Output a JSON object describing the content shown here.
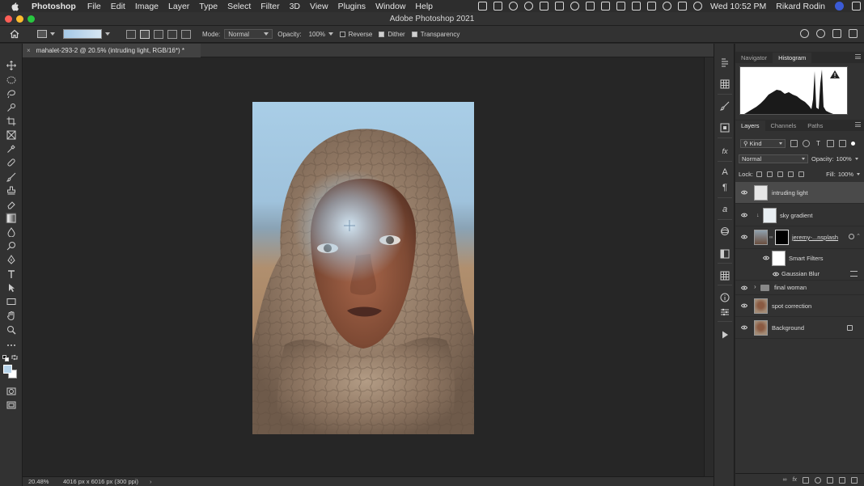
{
  "colors": {
    "menubar_bg": "#2d2d2d",
    "panel_bg": "#323232",
    "canvas_bg": "#262626",
    "foreground_color": "#b6d3ea",
    "background_color": "#ffffff",
    "selected_layer_bg": "#4a4a4a"
  },
  "menubar": {
    "app_name": "Photoshop",
    "menus": [
      "File",
      "Edit",
      "Image",
      "Layer",
      "Type",
      "Select",
      "Filter",
      "3D",
      "View",
      "Plugins",
      "Window",
      "Help"
    ],
    "clock": "Wed 10:52 PM",
    "user": "Rikard Rodin"
  },
  "window": {
    "title": "Adobe Photoshop 2021"
  },
  "options_bar": {
    "mode_label": "Mode:",
    "mode_value": "Normal",
    "opacity_label": "Opacity:",
    "opacity_value": "100%",
    "reverse_label": "Reverse",
    "reverse_checked": false,
    "dither_label": "Dither",
    "dither_checked": true,
    "transparency_label": "Transparency",
    "transparency_checked": true
  },
  "document": {
    "tab_title": "mahalet-293-2 @ 20.5% (intruding light, RGB/16*) *",
    "zoom": "20.48%",
    "dimensions": "4016 px x 6016 px (300 ppi)"
  },
  "panels": {
    "top_tabs": [
      "Navigator",
      "Histogram"
    ],
    "top_active": "Histogram",
    "layer_tabs": [
      "Layers",
      "Channels",
      "Paths"
    ],
    "layer_active": "Layers",
    "filter_kind": "Kind",
    "blend_mode": "Normal",
    "opacity_label": "Opacity:",
    "opacity_value": "100%",
    "lock_label": "Lock:",
    "fill_label": "Fill:",
    "fill_value": "100%"
  },
  "layers": [
    {
      "name": "intruding light",
      "selected": true
    },
    {
      "name": "sky gradient",
      "selected": false
    },
    {
      "name": "jeremy-...nsplash",
      "selected": false
    },
    {
      "name": "Smart Filters",
      "selected": false
    },
    {
      "name": "Gaussian Blur",
      "selected": false
    },
    {
      "name": "final woman",
      "selected": false
    },
    {
      "name": "spot correction",
      "selected": false
    },
    {
      "name": "Background",
      "selected": false
    }
  ]
}
